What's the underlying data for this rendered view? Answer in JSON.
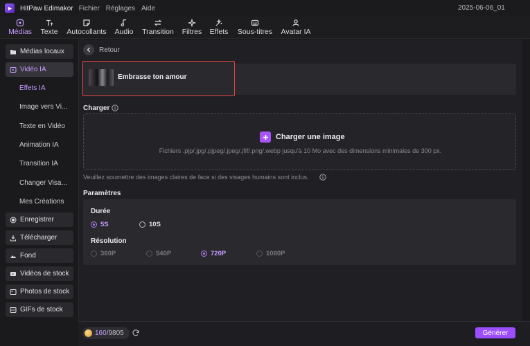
{
  "app": {
    "name": "HitPaw Edimakor",
    "menu": [
      "Fichier",
      "Réglages",
      "Aide"
    ],
    "project": "2025-06-06_01"
  },
  "toolbar": {
    "tabs": [
      {
        "label": "Médias",
        "icon": "media-icon",
        "active": true
      },
      {
        "label": "Texte",
        "icon": "text-icon"
      },
      {
        "label": "Autocollants",
        "icon": "sticker-icon"
      },
      {
        "label": "Audio",
        "icon": "audio-icon"
      },
      {
        "label": "Transition",
        "icon": "transition-icon"
      },
      {
        "label": "Filtres",
        "icon": "filter-icon"
      },
      {
        "label": "Effets",
        "icon": "effects-icon"
      },
      {
        "label": "Sous-titres",
        "icon": "subtitles-icon"
      },
      {
        "label": "Avatar IA",
        "icon": "avatar-icon"
      }
    ]
  },
  "sidebar": {
    "items": [
      {
        "label": "Médias locaux",
        "icon": "folder-icon"
      },
      {
        "label": "Vidéo IA",
        "icon": "ai-video-icon",
        "active": true
      },
      {
        "label": "Enregistrer",
        "icon": "record-icon"
      },
      {
        "label": "Télécharger",
        "icon": "download-icon"
      },
      {
        "label": "Fond",
        "icon": "background-icon"
      },
      {
        "label": "Vidéos de stock",
        "icon": "stock-video-icon"
      },
      {
        "label": "Photos de stock",
        "icon": "stock-photo-icon"
      },
      {
        "label": "GIFs de stock",
        "icon": "gif-icon"
      }
    ],
    "sub_items": [
      {
        "label": "Effets IA",
        "active": true
      },
      {
        "label": "Image vers Vi..."
      },
      {
        "label": "Texte en Vidéo"
      },
      {
        "label": "Animation IA"
      },
      {
        "label": "Transition IA"
      },
      {
        "label": "Changer Visa..."
      },
      {
        "label": "Mes Créations"
      }
    ]
  },
  "main": {
    "back_label": "Retour",
    "template_title": "Embrasse ton amour",
    "upload_section_label": "Charger",
    "upload_button_label": "Charger une image",
    "upload_hint": "Fichiers .pjp/.jpg/.pjpeg/.jpeg/.jfif/.png/.webp jusqu'à 10 Mo avec des dimensions minimales de 300 px.",
    "notice": "Veuillez soumettre des images claires de face si des visages humains sont inclus.",
    "params_label": "Paramètres",
    "duration_label": "Durée",
    "duration_options": [
      "5S",
      "10S"
    ],
    "duration_selected": "5S",
    "resolution_label": "Résolution",
    "resolution_options": [
      "360P",
      "540P",
      "720P",
      "1080P"
    ],
    "resolution_selected": "720P"
  },
  "footer": {
    "credits_used": "160",
    "credits_total": "/9805",
    "generate_label": "Générer"
  },
  "colors": {
    "accent": "#9b4dff",
    "accent_text": "#c79cff",
    "highlight_border": "#e0443e",
    "background": "#17171a"
  }
}
